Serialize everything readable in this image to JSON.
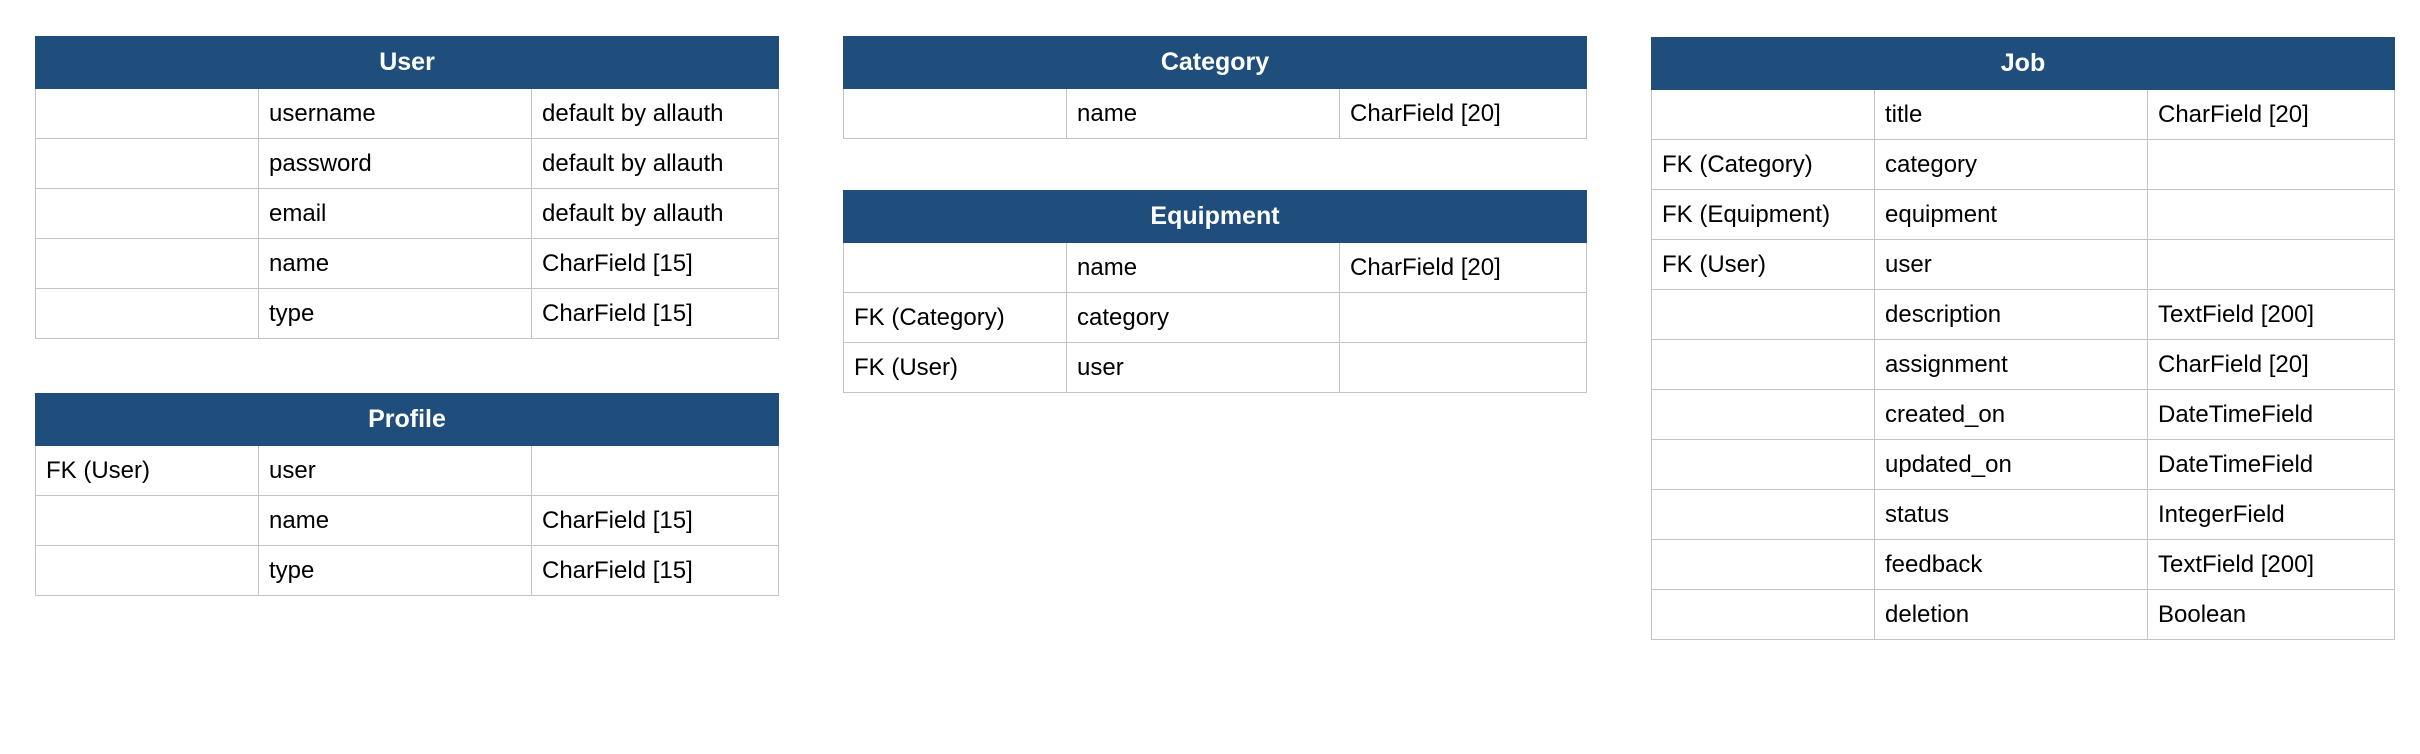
{
  "tables": [
    {
      "id": "user",
      "title": "User",
      "rows": [
        [
          "",
          "username",
          "default by allauth"
        ],
        [
          "",
          "password",
          "default by allauth"
        ],
        [
          "",
          "email",
          "default by allauth"
        ],
        [
          "",
          "name",
          "CharField [15]"
        ],
        [
          "",
          "type",
          "CharField [15]"
        ]
      ]
    },
    {
      "id": "profile",
      "title": "Profile",
      "rows": [
        [
          "FK (User)",
          "user",
          ""
        ],
        [
          "",
          "name",
          "CharField [15]"
        ],
        [
          "",
          "type",
          "CharField [15]"
        ]
      ]
    },
    {
      "id": "category",
      "title": "Category",
      "rows": [
        [
          "",
          "name",
          "CharField [20]"
        ]
      ]
    },
    {
      "id": "equipment",
      "title": "Equipment",
      "rows": [
        [
          "",
          "name",
          "CharField [20]"
        ],
        [
          "FK (Category)",
          "category",
          ""
        ],
        [
          "FK (User)",
          "user",
          ""
        ]
      ]
    },
    {
      "id": "job",
      "title": "Job",
      "rows": [
        [
          "",
          "title",
          "CharField [20]"
        ],
        [
          "FK (Category)",
          "category",
          ""
        ],
        [
          "FK (Equipment)",
          "equipment",
          ""
        ],
        [
          "FK (User)",
          "user",
          ""
        ],
        [
          "",
          "description",
          "TextField [200]"
        ],
        [
          "",
          "assignment",
          "CharField [20]"
        ],
        [
          "",
          "created_on",
          "DateTimeField"
        ],
        [
          "",
          "updated_on",
          "DateTimeField"
        ],
        [
          "",
          "status",
          "IntegerField"
        ],
        [
          "",
          "feedback",
          "TextField [200]"
        ],
        [
          "",
          "deletion",
          "Boolean"
        ]
      ]
    }
  ],
  "colors": {
    "header_bg": "#1f4e7c",
    "header_text": "#ffffff",
    "grid_line": "#c4c4c4"
  }
}
